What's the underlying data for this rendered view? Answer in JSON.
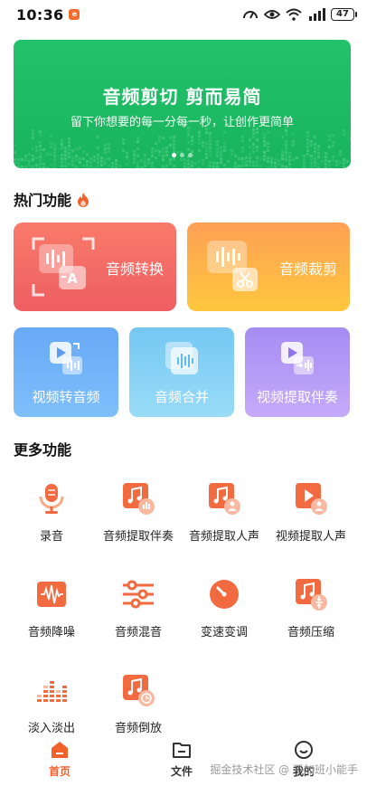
{
  "status_bar": {
    "time": "10:36",
    "battery": "47"
  },
  "banner": {
    "title": "音频剪切 剪而易简",
    "subtitle": "留下你想要的每一分每一秒，让创作更简单"
  },
  "hot_section": {
    "title": "热门功能"
  },
  "hot_cards": [
    {
      "label": "音频转换"
    },
    {
      "label": "音频裁剪"
    }
  ],
  "mid_cards": [
    {
      "label": "视频转音频"
    },
    {
      "label": "音频合并"
    },
    {
      "label": "视频提取伴奏"
    }
  ],
  "more_section": {
    "title": "更多功能"
  },
  "more_items": [
    {
      "label": "录音",
      "icon": "microphone-icon"
    },
    {
      "label": "音频提取伴奏",
      "icon": "music-note-icon"
    },
    {
      "label": "音频提取人声",
      "icon": "music-person-icon"
    },
    {
      "label": "视频提取人声",
      "icon": "video-person-icon"
    },
    {
      "label": "音频降噪",
      "icon": "waveform-icon"
    },
    {
      "label": "音频混音",
      "icon": "mixer-sliders-icon"
    },
    {
      "label": "变速变调",
      "icon": "speed-dial-icon"
    },
    {
      "label": "音频压缩",
      "icon": "compress-icon"
    },
    {
      "label": "淡入淡出",
      "icon": "equalizer-bars-icon"
    },
    {
      "label": "音频倒放",
      "icon": "reverse-play-icon"
    }
  ],
  "tab_bar": {
    "tabs": [
      {
        "label": "首页",
        "icon": "home-icon"
      },
      {
        "label": "文件",
        "icon": "folder-icon"
      },
      {
        "label": "我的",
        "icon": "smiley-icon"
      }
    ],
    "watermark": "掘金技术社区 @ 不加班小能手"
  },
  "colors": {
    "accent": "#f0612c",
    "banner_green": "#1fbd66",
    "icon_orange": "#f26a3f"
  }
}
